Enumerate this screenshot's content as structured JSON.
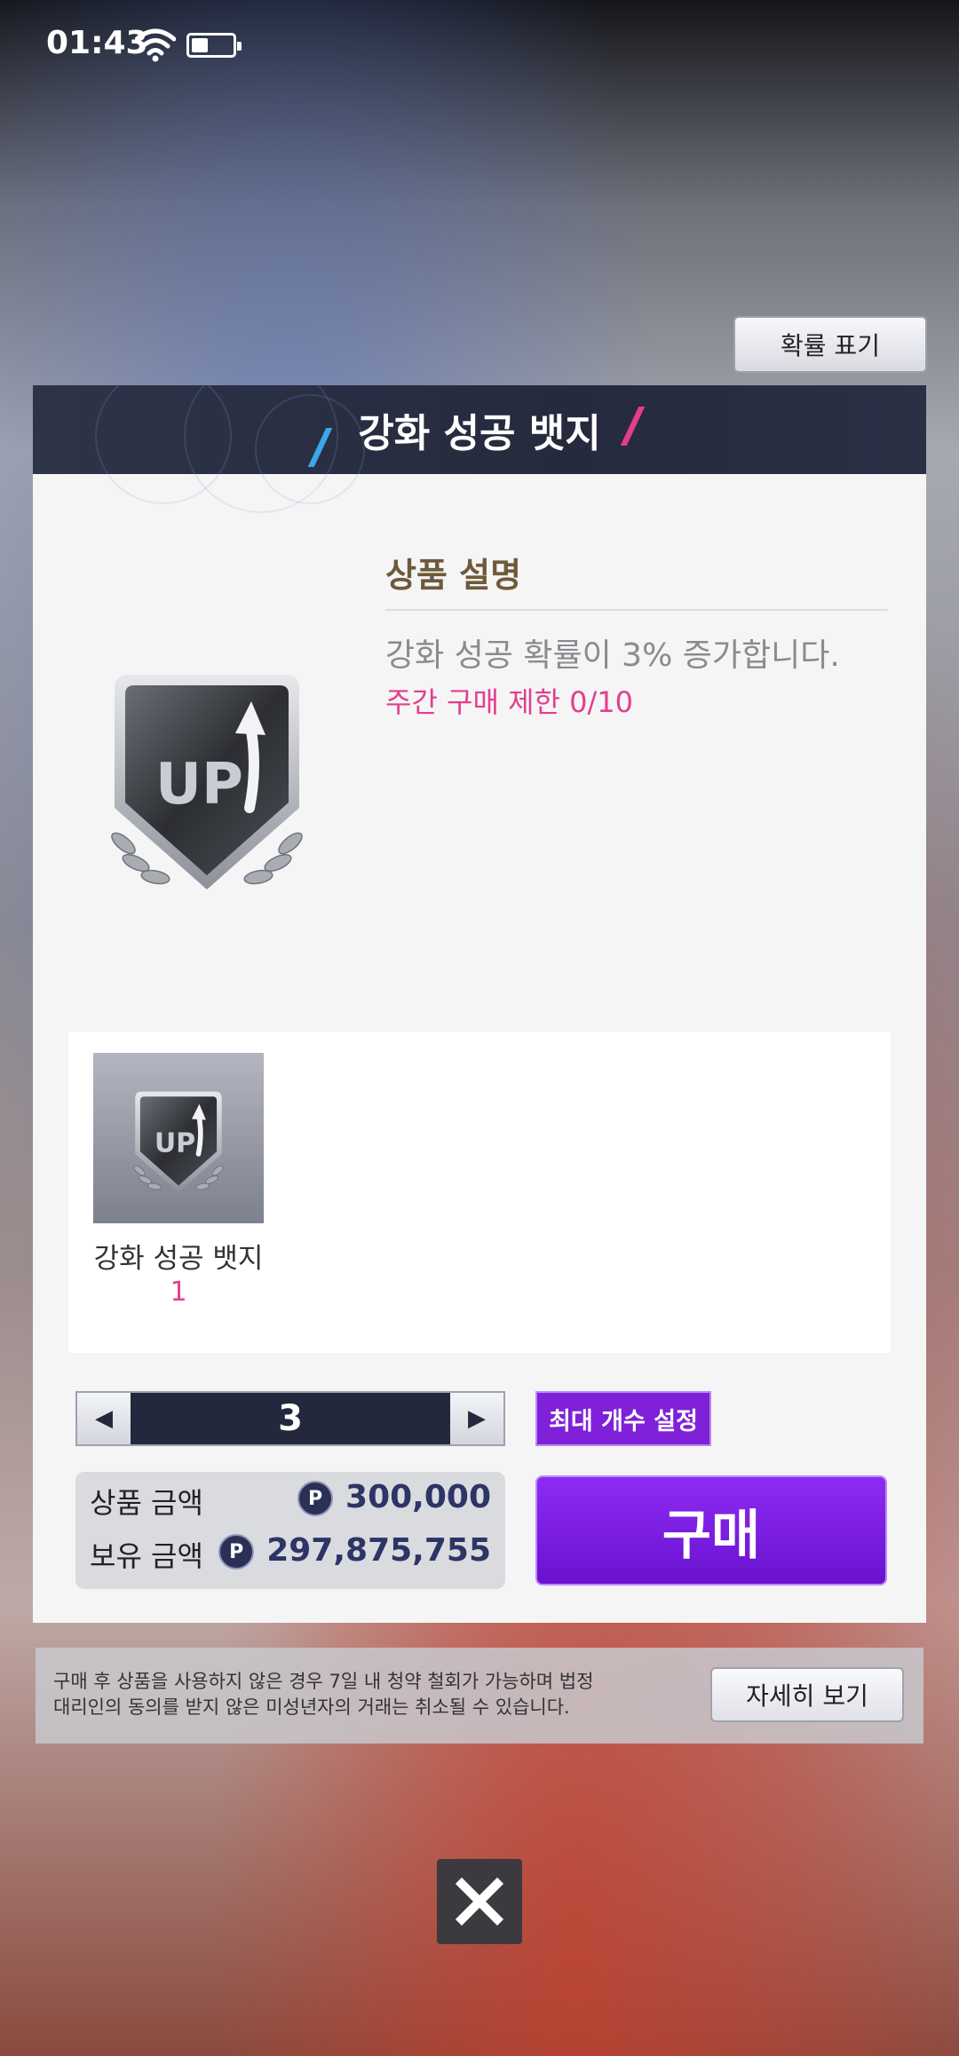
{
  "status_bar": {
    "time": "01:43",
    "battery_level": 0.4
  },
  "probability_button": {
    "label": "확률 표기"
  },
  "dialog": {
    "title": "강화 성공 뱃지",
    "badge_text": "UP",
    "description": {
      "heading": "상품 설명",
      "text": "강화 성공 확률이 3% 증가합니다.",
      "weekly_limit": "주간 구매 제한 0/10"
    },
    "item": {
      "name": "강화 성공 뱃지",
      "quantity": "1"
    },
    "stepper": {
      "value": "3"
    },
    "max_button": "최대 개수 설정",
    "price": {
      "product_label": "상품 금액",
      "product_value": "300,000",
      "owned_label": "보유 금액",
      "owned_value": "297,875,755",
      "currency_symbol": "P"
    },
    "buy_button": "구매"
  },
  "notice": {
    "line1": "구매 후 상품을 사용하지 않은 경우 7일 내 청약 철회가 가능하며 법정",
    "line2": "대리인의 동의를 받지 않은 미성년자의 거래는 취소될 수 있습니다.",
    "detail_button": "자세히 보기"
  },
  "colors": {
    "accent_purple": "#7f21d9",
    "pink": "#e23f8e",
    "header": "#252a3d"
  }
}
